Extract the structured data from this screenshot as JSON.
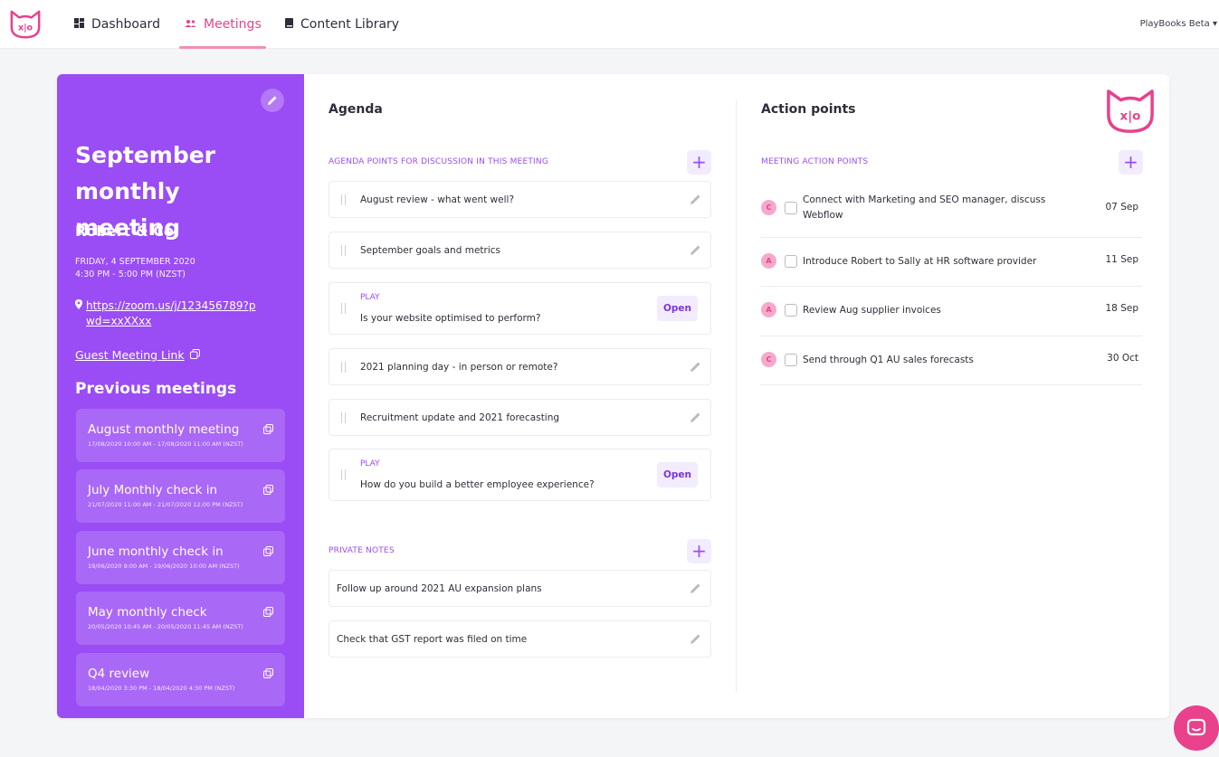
{
  "nav": {
    "items": [
      {
        "label": "Dashboard"
      },
      {
        "label": "Meetings"
      },
      {
        "label": "Content Library"
      }
    ],
    "account": "PlayBooks Beta"
  },
  "meeting": {
    "title": "September monthly meeting",
    "company": "Robert & Co.",
    "date": "FRIDAY, 4 SEPTEMBER 2020",
    "time": "4:30 PM - 5:00 PM (NZST)",
    "link": "https://zoom.us/j/123456789?pwd=xxXXxx",
    "guest_link": "Guest Meeting Link"
  },
  "previous": {
    "title": "Previous meetings",
    "items": [
      {
        "name": "August monthly meeting",
        "time": "17/08/2020 10:00 AM - 17/08/2020 11:00 AM (NZST)"
      },
      {
        "name": "July Monthly check in",
        "time": "21/07/2020 11:00 AM - 21/07/2020 12:00 PM (NZST)"
      },
      {
        "name": "June monthly check in",
        "time": "19/06/2020 9:00 AM - 19/06/2020 10:00 AM (NZST)"
      },
      {
        "name": "May monthly check",
        "time": "20/05/2020 10:45 AM - 20/05/2020 11:45 AM (NZST)"
      },
      {
        "name": "Q4 review",
        "time": "18/04/2020 3:30 PM - 18/04/2020 4:30 PM (NZST)"
      }
    ]
  },
  "agenda": {
    "heading": "Agenda",
    "section_label": "AGENDA POINTS FOR DISCUSSION IN THIS MEETING",
    "items": [
      {
        "text": "August review - what went well?"
      },
      {
        "text": "September goals and metrics"
      },
      {
        "play": "PLAY",
        "text": "Is your website optimised to perform?",
        "action": "Open"
      },
      {
        "text": "2021 planning day - in person or remote?"
      },
      {
        "text": "Recruitment update and 2021 forecasting"
      },
      {
        "play": "PLAY",
        "text": "How do you build a better employee experience?",
        "action": "Open"
      }
    ]
  },
  "notes": {
    "section_label": "PRIVATE NOTES",
    "items": [
      {
        "text": "Follow up around 2021 AU expansion plans"
      },
      {
        "text": "Check that GST report was filed on time"
      }
    ]
  },
  "actions": {
    "heading": "Action points",
    "section_label": "MEETING ACTION POINTS",
    "items": [
      {
        "initial": "C",
        "text": "Connect with Marketing and SEO manager, discuss Webflow",
        "date": "07 Sep"
      },
      {
        "initial": "A",
        "text": "Introduce Robert to Sally at HR software provider",
        "date": "11 Sep"
      },
      {
        "initial": "A",
        "text": "Review Aug supplier invoices",
        "date": "18 Sep"
      },
      {
        "initial": "C",
        "text": "Send through Q1 AU sales forecasts",
        "date": "30 Oct"
      }
    ]
  },
  "icons": {
    "add": "+",
    "dashboard": "dashboard-icon",
    "meetings": "people-icon",
    "library": "book-icon",
    "edit": "pencil-icon",
    "copy": "copy-icon",
    "location": "pin-icon",
    "chat": "chat-icon"
  },
  "colors": {
    "brand_purple": "#9a4cf5",
    "brand_pink": "#e9418b",
    "accent_light": "#f3ecfe"
  }
}
